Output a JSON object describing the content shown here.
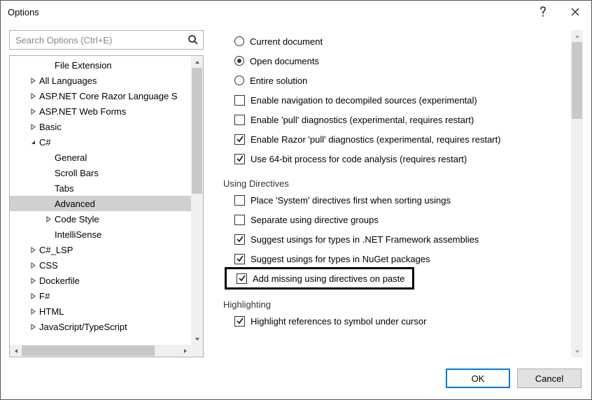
{
  "window": {
    "title": "Options"
  },
  "search": {
    "placeholder": "Search Options (Ctrl+E)"
  },
  "tree": {
    "items": [
      {
        "label": "File Extension",
        "indent": 2,
        "twisty": "none"
      },
      {
        "label": "All Languages",
        "indent": 1,
        "twisty": "closed"
      },
      {
        "label": "ASP.NET Core Razor Language S",
        "indent": 1,
        "twisty": "closed"
      },
      {
        "label": "ASP.NET Web Forms",
        "indent": 1,
        "twisty": "closed"
      },
      {
        "label": "Basic",
        "indent": 1,
        "twisty": "closed"
      },
      {
        "label": "C#",
        "indent": 1,
        "twisty": "open"
      },
      {
        "label": "General",
        "indent": 2,
        "twisty": "none"
      },
      {
        "label": "Scroll Bars",
        "indent": 2,
        "twisty": "none"
      },
      {
        "label": "Tabs",
        "indent": 2,
        "twisty": "none"
      },
      {
        "label": "Advanced",
        "indent": 2,
        "twisty": "none",
        "selected": true
      },
      {
        "label": "Code Style",
        "indent": 2,
        "twisty": "closed"
      },
      {
        "label": "IntelliSense",
        "indent": 2,
        "twisty": "none"
      },
      {
        "label": "C#_LSP",
        "indent": 1,
        "twisty": "closed"
      },
      {
        "label": "CSS",
        "indent": 1,
        "twisty": "closed"
      },
      {
        "label": "Dockerfile",
        "indent": 1,
        "twisty": "closed"
      },
      {
        "label": "F#",
        "indent": 1,
        "twisty": "closed"
      },
      {
        "label": "HTML",
        "indent": 1,
        "twisty": "closed"
      },
      {
        "label": "JavaScript/TypeScript",
        "indent": 1,
        "twisty": "closed"
      }
    ]
  },
  "settings": {
    "radios": [
      {
        "label": "Current document",
        "checked": false
      },
      {
        "label": "Open documents",
        "checked": true
      },
      {
        "label": "Entire solution",
        "checked": false
      }
    ],
    "topChecks": [
      {
        "label": "Enable navigation to decompiled sources (experimental)",
        "checked": false
      },
      {
        "label": "Enable 'pull' diagnostics (experimental, requires restart)",
        "checked": false
      },
      {
        "label": "Enable Razor 'pull' diagnostics (experimental, requires restart)",
        "checked": true
      },
      {
        "label": "Use 64-bit process for code analysis (requires restart)",
        "checked": true
      }
    ],
    "group1": {
      "title": "Using Directives"
    },
    "usingChecks": [
      {
        "label": "Place 'System' directives first when sorting usings",
        "checked": false
      },
      {
        "label": "Separate using directive groups",
        "checked": false
      },
      {
        "label": "Suggest usings for types in .NET Framework assemblies",
        "checked": true
      },
      {
        "label": "Suggest usings for types in NuGet packages",
        "checked": true
      }
    ],
    "highlighted": {
      "label": "Add missing using directives on paste",
      "checked": true
    },
    "group2": {
      "title": "Highlighting"
    },
    "hlChecks": [
      {
        "label": "Highlight references to symbol under cursor",
        "checked": true
      }
    ]
  },
  "footer": {
    "ok": "OK",
    "cancel": "Cancel"
  }
}
